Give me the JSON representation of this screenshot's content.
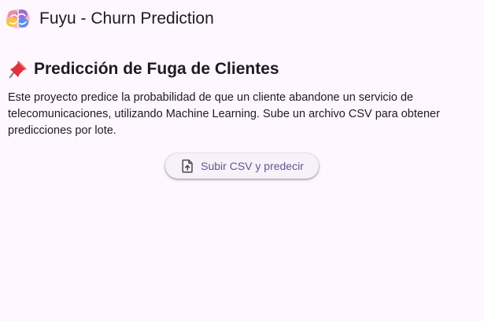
{
  "appbar": {
    "logo_icon": "brain-icon",
    "title": "Fuyu - Churn Prediction"
  },
  "main": {
    "heading_icon": "pushpin-icon",
    "heading": "Predicción de Fuga de Clientes",
    "description": "Este proyecto predice la probabilidad de que un cliente abandone un servicio de telecomunicaciones, utilizando Machine Learning. Sube un archivo CSV para obtener predicciones por lote.",
    "upload_button": {
      "icon": "file-upload-icon",
      "label": "Subir CSV y predecir"
    }
  },
  "colors": {
    "background": "#fef7ff",
    "text": "#1d1b20",
    "button_background": "#f7f2fa",
    "button_text": "#65558f"
  }
}
